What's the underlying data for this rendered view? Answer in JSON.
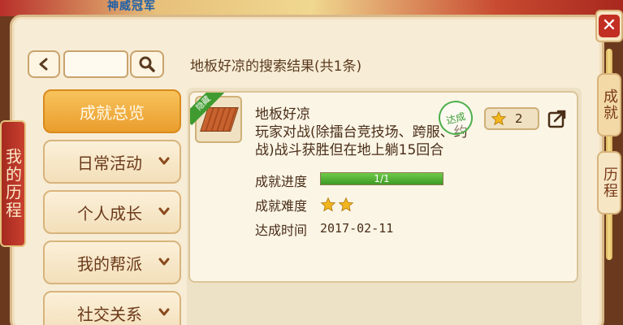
{
  "banner": {
    "text": "神威冠军"
  },
  "left_tab": {
    "label": "我的历程"
  },
  "right_tabs": [
    {
      "label": "成就"
    },
    {
      "label": "历程"
    }
  ],
  "close": {
    "label": "✕"
  },
  "search": {
    "value": "",
    "placeholder": ""
  },
  "results": {
    "title": "地板好凉的搜索结果(共1条)"
  },
  "menu": [
    {
      "label": "成就总览",
      "active": true
    },
    {
      "label": "日常活动",
      "active": false
    },
    {
      "label": "个人成长",
      "active": false
    },
    {
      "label": "我的帮派",
      "active": false
    },
    {
      "label": "社交关系",
      "active": false
    }
  ],
  "achievement": {
    "ribbon": "隐藏",
    "name": "地板好凉",
    "description": "玩家对战(除擂台竞技场、跨服、约战)战斗获胜但在地上躺15回合",
    "stamp": "达成",
    "points": "2",
    "progress_label": "成就进度",
    "progress_text": "1/1",
    "progress_fraction": 1.0,
    "difficulty_label": "成就难度",
    "difficulty_stars": 2,
    "date_label": "达成时间",
    "date": "2017-02-11"
  },
  "colors": {
    "accent": "#ea9d2d",
    "progress": "#3e9a25",
    "star": "#f2b51d"
  }
}
